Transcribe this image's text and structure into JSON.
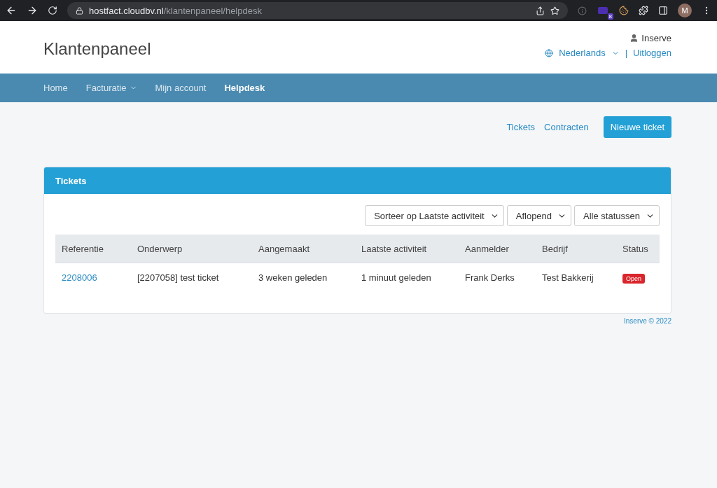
{
  "browser": {
    "url_domain": "hostfact.cloudbv.nl",
    "url_path": "/klantenpaneel/helpdesk",
    "extension_badge": "8",
    "profile_initial": "M"
  },
  "header": {
    "title": "Klantenpaneel",
    "user": "Inserve",
    "language": "Nederlands",
    "separator": "|",
    "logout": "Uitloggen"
  },
  "nav": [
    {
      "label": "Home",
      "selected": false,
      "dropdown": false
    },
    {
      "label": "Facturatie",
      "selected": false,
      "dropdown": true
    },
    {
      "label": "Mijn account",
      "selected": false,
      "dropdown": false
    },
    {
      "label": "Helpdesk",
      "selected": true,
      "dropdown": false
    }
  ],
  "actions": {
    "links": [
      "Tickets",
      "Contracten"
    ],
    "button": "Nieuwe ticket"
  },
  "panel": {
    "title": "Tickets",
    "filters": [
      "Sorteer op Laatste activiteit",
      "Aflopend",
      "Alle statussen"
    ],
    "columns": [
      "Referentie",
      "Onderwerp",
      "Aangemaakt",
      "Laatste activiteit",
      "Aanmelder",
      "Bedrijf",
      "Status"
    ],
    "rows": [
      {
        "reference": "2208006",
        "subject": "[2207058] test ticket",
        "created": "3 weken geleden",
        "last_activity": "1 minuut geleden",
        "reporter": "Frank Derks",
        "company": "Test Bakkerij",
        "status": "Open",
        "color": "#d9262c"
      }
    ]
  },
  "footer": "Inserve © 2022"
}
